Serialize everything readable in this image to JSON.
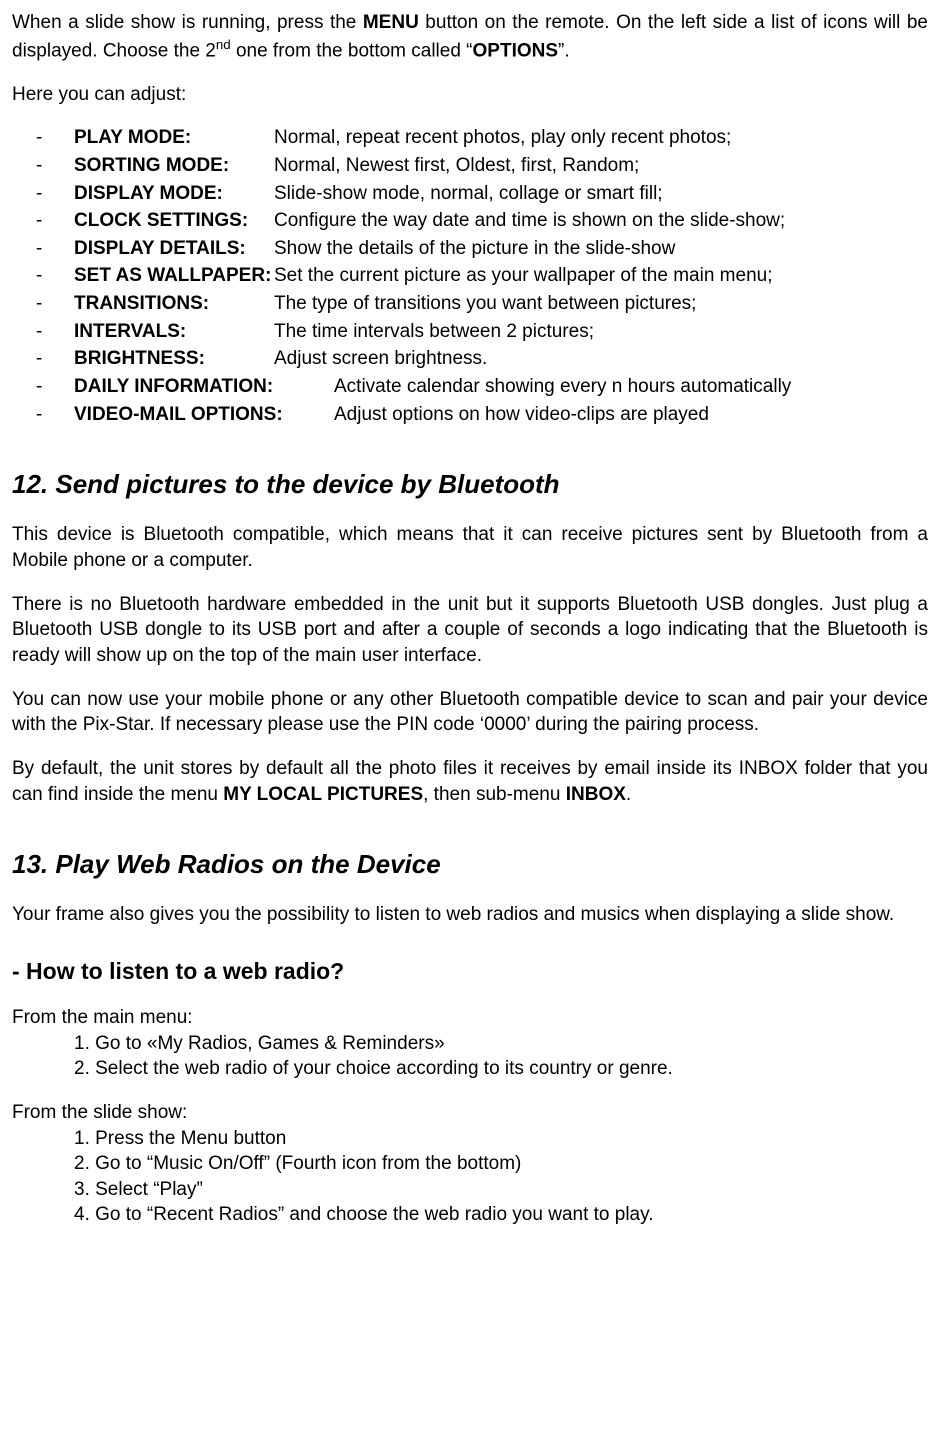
{
  "intro_pre": "When a slide show is running, press the ",
  "intro_menu": "MENU",
  "intro_mid": " button on the remote. On the left side a list of icons will be displayed. Choose the 2",
  "intro_sup": "nd",
  "intro_post": " one from the bottom called “",
  "intro_options": "OPTIONS",
  "intro_end": "”.",
  "adjust": "Here you can adjust:",
  "opts": [
    {
      "label": "PLAY MODE:",
      "desc": "Normal, repeat recent photos, play only recent photos;",
      "wide": false
    },
    {
      "label": "SORTING MODE:",
      "desc": "Normal, Newest first, Oldest, first, Random;",
      "wide": false
    },
    {
      "label": "DISPLAY MODE:",
      "desc": "Slide-show mode, normal, collage or smart fill;",
      "wide": false
    },
    {
      "label": "CLOCK SETTINGS:",
      "desc": "Configure the way date and time is shown on the slide-show;",
      "wide": false
    },
    {
      "label": "DISPLAY DETAILS:",
      "desc": "Show the details of the picture in the slide-show",
      "wide": false
    },
    {
      "label": "SET AS WALLPAPER:",
      "desc": "Set the current picture as your wallpaper of the main menu;",
      "wide": false
    },
    {
      "label": "TRANSITIONS:",
      "desc": "The type of transitions you want between pictures;",
      "wide": false
    },
    {
      "label": "INTERVALS:",
      "desc": "The time intervals between 2 pictures;",
      "wide": false
    },
    {
      "label": "BRIGHTNESS:",
      "desc": "Adjust screen brightness.",
      "wide": false
    },
    {
      "label": "DAILY INFORMATION:",
      "desc": "Activate calendar showing every n hours automatically",
      "wide": true
    },
    {
      "label": "VIDEO-MAIL OPTIONS:",
      "desc": "Adjust options on how video-clips are played",
      "wide": true
    }
  ],
  "h12": "12. Send pictures to the device by Bluetooth",
  "p12a": "This device is Bluetooth compatible, which means that it can receive pictures sent by Bluetooth from a Mobile phone or a computer.",
  "p12b": "There is no Bluetooth hardware embedded in the unit but it supports Bluetooth USB dongles. Just plug a Bluetooth USB dongle to its USB port and after a couple of seconds a logo indicating that the Bluetooth is ready will show up on the top of the main user interface.",
  "p12c": "You can now use your mobile phone or any other Bluetooth compatible device to scan and pair your device with the Pix-Star. If necessary please use the PIN code ‘0000’ during the pairing process.",
  "p12d_pre": "By default, the unit stores by default all the photo files it receives by email inside its INBOX folder that you can find inside the menu ",
  "p12d_b1": "MY LOCAL PICTURES",
  "p12d_mid": ", then sub-menu ",
  "p12d_b2": "INBOX",
  "p12d_end": ".",
  "h13": "13. Play Web Radios on the Device",
  "p13a": "Your frame also gives you the possibility to listen to web radios and musics when displaying a slide show.",
  "h13q": "- How to listen to a web radio?",
  "mainmenu_lead": "From the main menu:",
  "mainmenu_steps": [
    "1. Go to «My Radios, Games & Reminders»",
    "2. Select the web radio of your choice according to its country or genre."
  ],
  "slideshow_lead": "From the slide show:",
  "slideshow_steps": [
    "1. Press the Menu button",
    "2. Go to “Music On/Off” (Fourth icon from the bottom)",
    "3. Select “Play”",
    "4. Go to “Recent Radios” and choose the web radio you want to play."
  ]
}
